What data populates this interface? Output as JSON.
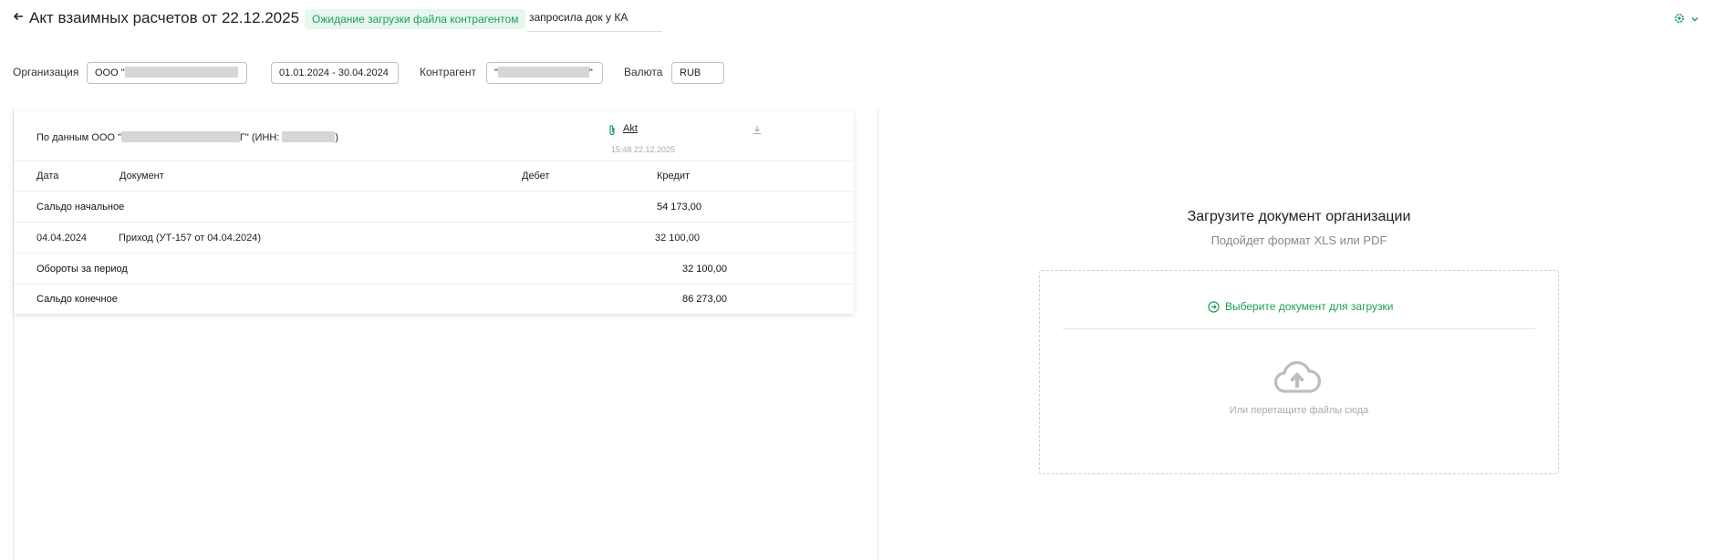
{
  "header": {
    "back_icon": "arrow-left-icon",
    "title": "Акт взаимных расчетов от 22.12.2025",
    "status_badge": "Ожидание загрузки файла контрагентом",
    "comment": "запросила док у КА",
    "settings_icon": "gear-icon",
    "menu_icon": "chevron-down-icon"
  },
  "filters": {
    "organization_label": "Организация",
    "organization_value": "ООО \"",
    "period_value": "01.01.2024 - 30.04.2024",
    "counterparty_label": "Контрагент",
    "counterparty_value_start": "\"",
    "counterparty_value_end": "\"",
    "currency_label": "Валюта",
    "currency_value": "RUB"
  },
  "act": {
    "source_prefix": "По данным ООО \"",
    "source_mid": "Г\" (ИНН: ",
    "source_end": ")",
    "attachment_icon": "paperclip-icon",
    "attachment_name": "Akt",
    "attachment_time": "15:48 22.12.2025",
    "download_icon": "download-icon",
    "columns": {
      "date": "Дата",
      "document": "Документ",
      "debit": "Дебет",
      "credit": "Кредит"
    },
    "opening_label": "Сальдо начальное",
    "opening_credit": "54 173,00",
    "rows": [
      {
        "date": "04.04.2024",
        "document": "Приход (УТ-157 от 04.04.2024)",
        "debit": "",
        "credit": "32 100,00"
      }
    ],
    "turnover_label": "Обороты за период",
    "turnover_credit": "32 100,00",
    "closing_label": "Сальдо конечное",
    "closing_credit": "86 273,00"
  },
  "upload": {
    "title": "Загрузите документ организации",
    "subtitle": "Подойдет формат XLS или PDF",
    "choose_icon": "arrow-right-circle-icon",
    "choose_label": "Выберите документ для загрузки",
    "cloud_icon": "cloud-upload-icon",
    "drag_hint": "Или перетащите файлы сюда"
  },
  "colors": {
    "accent": "#1a9e5a",
    "badge_bg": "#e7f6ee"
  }
}
